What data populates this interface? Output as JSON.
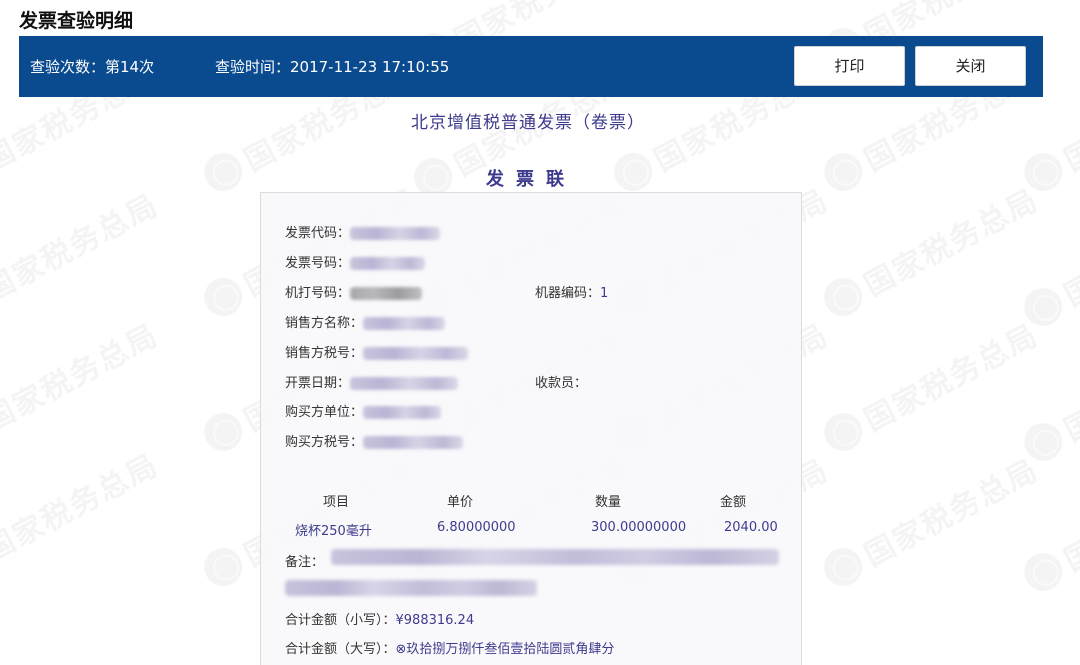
{
  "page": {
    "title": "发票查验明细"
  },
  "toolbar": {
    "check_count": "查验次数：第14次",
    "check_time": "查验时间：2017-11-23 17:10:55",
    "print_label": "打印",
    "close_label": "关闭"
  },
  "invoice": {
    "title": "北京增值税普通发票（卷票）",
    "copy_label": "发票联",
    "fields": {
      "invoice_code_label": "发票代码：",
      "invoice_number_label": "发票号码：",
      "machine_number_label": "机打号码：",
      "machine_code_label": "机器编码：",
      "machine_code_value": "1",
      "seller_name_label": "销售方名称：",
      "seller_tax_label": "销售方税号：",
      "issue_date_label": "开票日期：",
      "cashier_label": "收款员：",
      "buyer_unit_label": "购买方单位：",
      "buyer_tax_label": "购买方税号："
    },
    "items": {
      "headers": [
        "项目",
        "单价",
        "数量",
        "金额"
      ],
      "rows": [
        {
          "name": "烧杯250毫升",
          "unit_price": "6.80000000",
          "quantity": "300.00000000",
          "amount": "2040.00"
        }
      ]
    },
    "remark_label": "备注：",
    "total_small_label": "合计金额（小写）：",
    "total_small_value": "¥988316.24",
    "total_big_label": "合计金额（大写）：",
    "total_big_value": "⊗玖拾捌万捌仟叁佰壹拾陆圆贰角肆分"
  },
  "watermark": {
    "text": "国家税务总局",
    "color": "#ececec"
  },
  "colors": {
    "toolbar_bg": "#0a4b8f",
    "invoice_text": "#3d3b8e"
  }
}
